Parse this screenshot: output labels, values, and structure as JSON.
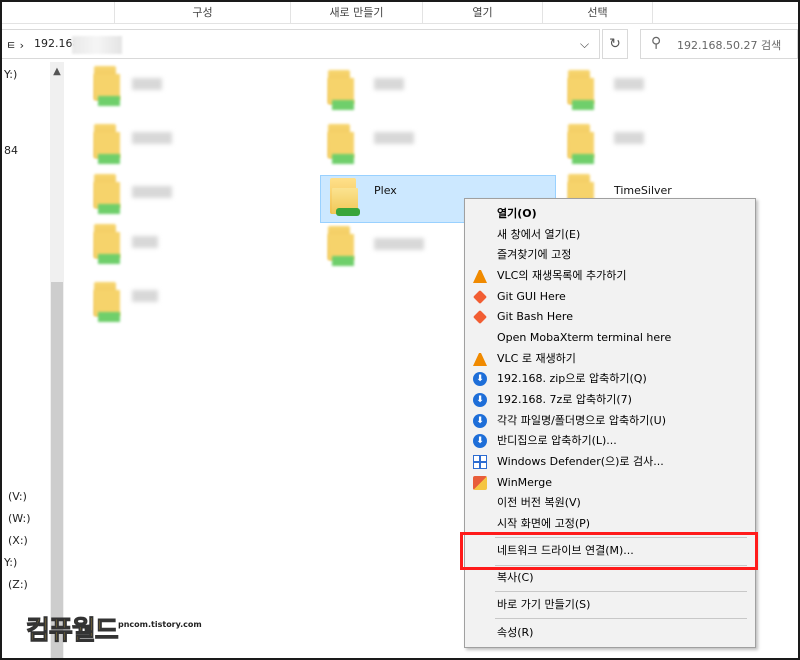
{
  "ribbon": {
    "groups": [
      "구성",
      "새로 만들기",
      "열기",
      "선택"
    ]
  },
  "address": {
    "prefix": "ㅌ ›",
    "path": "192.168",
    "dropdown": "⌵",
    "refresh": "↻"
  },
  "search": {
    "placeholder": "192.168.50.27 검색"
  },
  "nav": {
    "items": [
      "Y:)",
      "84",
      "(V:)",
      "(W:)",
      "(X:)",
      "Y:)",
      "(Z:)"
    ]
  },
  "folders": {
    "plex": "Plex",
    "timesilver": "TimeSilver"
  },
  "menu": {
    "items": [
      {
        "label": "열기(O)",
        "bold": true,
        "icon": ""
      },
      {
        "label": "새 창에서 열기(E)",
        "icon": ""
      },
      {
        "label": "즐겨찾기에 고정",
        "icon": ""
      },
      {
        "label": "VLC의 재생목록에 추가하기",
        "icon": "vlc-icon"
      },
      {
        "label": "Git GUI Here",
        "icon": "git-icon"
      },
      {
        "label": "Git Bash Here",
        "icon": "git-icon"
      },
      {
        "label": "Open MobaXterm terminal here",
        "icon": ""
      },
      {
        "label": "VLC 로 재생하기",
        "icon": "vlc-icon"
      },
      {
        "label": "192.168.      zip으로 압축하기(Q)",
        "icon": "bandizip-icon"
      },
      {
        "label": "192.168.      7z로 압축하기(7)",
        "icon": "bandizip-icon"
      },
      {
        "label": "각각 파일명/폴더명으로 압축하기(U)",
        "icon": "bandizip-icon"
      },
      {
        "label": "반디집으로 압축하기(L)...",
        "icon": "bandizip-icon"
      },
      {
        "label": "Windows Defender(으)로 검사...",
        "icon": "defender-icon"
      },
      {
        "label": "WinMerge",
        "icon": "winmerge-icon"
      },
      {
        "label": "이전 버전 복원(V)",
        "icon": ""
      },
      {
        "label": "시작 화면에 고정(P)",
        "icon": ""
      },
      {
        "label": "네트워크 드라이브 연결(M)...",
        "icon": ""
      },
      {
        "label": "복사(C)",
        "icon": ""
      },
      {
        "label": "바로 가기 만들기(S)",
        "icon": ""
      },
      {
        "label": "속성(R)",
        "icon": ""
      }
    ]
  },
  "watermark": {
    "title": "컴퓨월드",
    "site": "pncom.tistory.com"
  },
  "colors": {
    "selection": "#cce8ff",
    "highlight": "#ff1a1a",
    "menu_bg": "#f2f2f2"
  }
}
